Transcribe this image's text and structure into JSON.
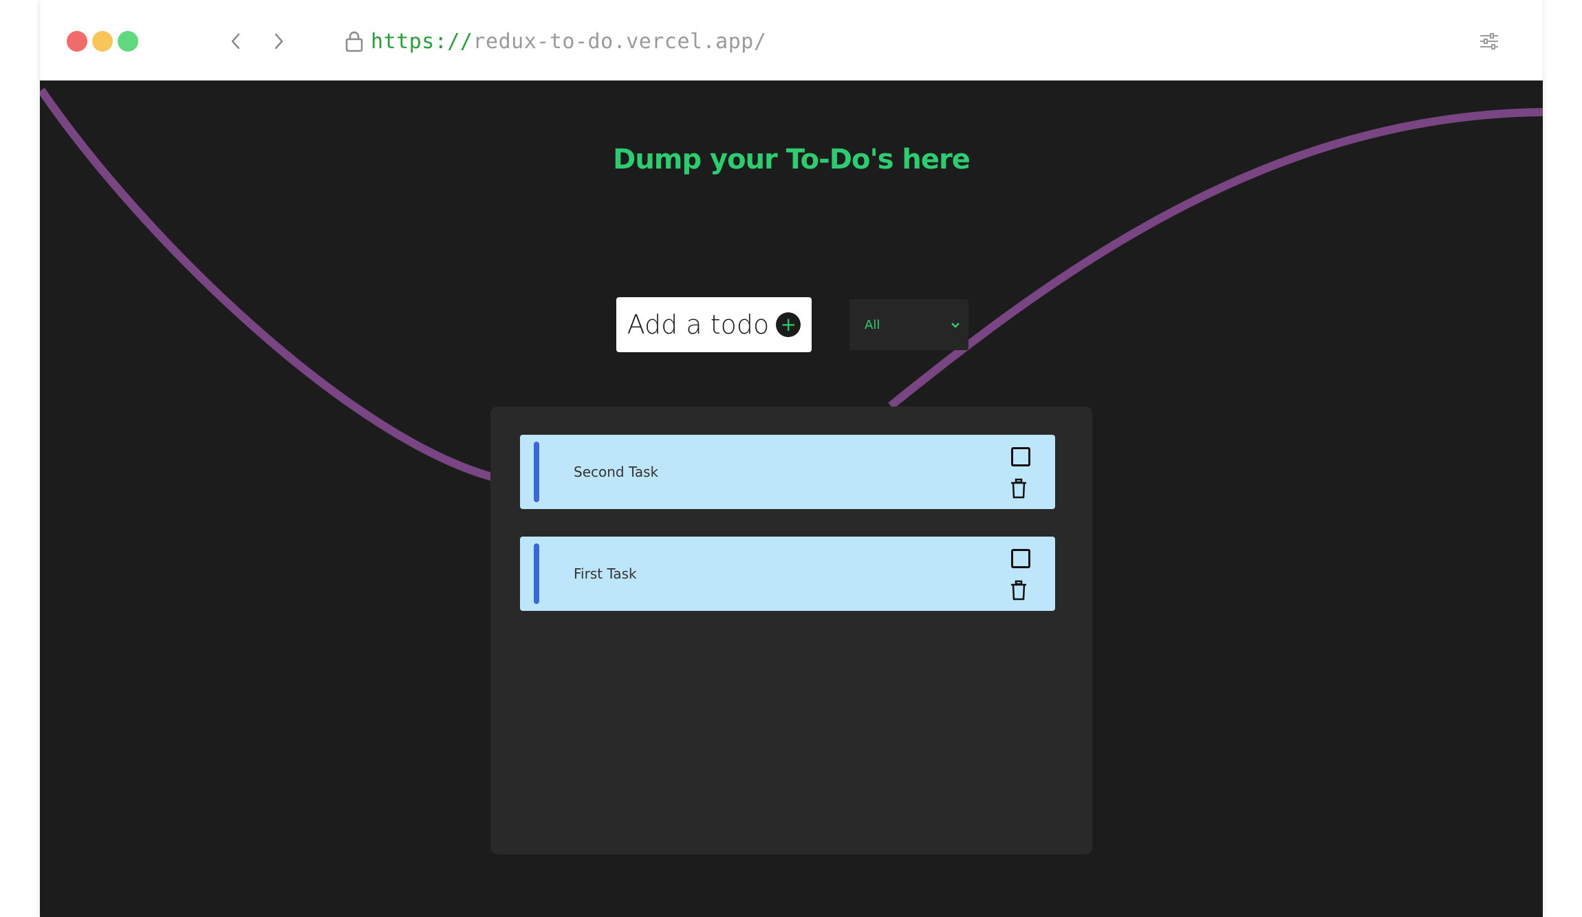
{
  "browser": {
    "url_scheme": "https://",
    "url_host": "redux-to-do.vercel.app/",
    "traffic_lights": [
      "#f16b6b",
      "#f8c55a",
      "#5fd87e"
    ],
    "icons": [
      "lock-icon",
      "back-arrow-icon",
      "forward-arrow-icon",
      "sliders-icon"
    ]
  },
  "app": {
    "heading": "Dump your To-Do's here",
    "add_button_label": "Add a todo",
    "filter_value": "All",
    "colors": {
      "background": "#1c1c1c",
      "accent": "#2ecc71",
      "wave": "#7a4583",
      "panel": "#292929",
      "todo_card": "#bee6fa",
      "todo_bar": "#3a68d8"
    }
  },
  "todos": [
    {
      "text": "Second Task",
      "completed": false
    },
    {
      "text": "First Task",
      "completed": false
    }
  ]
}
